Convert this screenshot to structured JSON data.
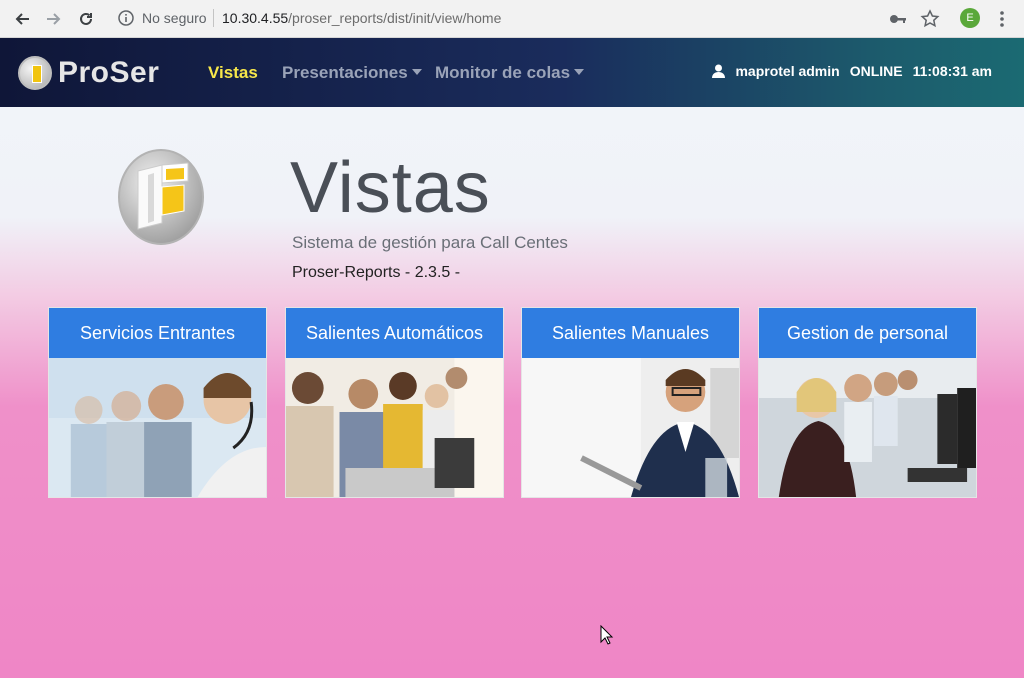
{
  "browser": {
    "security_label": "No seguro",
    "url_host": "10.30.4.55",
    "url_path": "/proser_reports/dist/init/view/home",
    "profile_initial": "E"
  },
  "navbar": {
    "brand": "ProSer",
    "links": [
      {
        "label": "Vistas",
        "active": true
      },
      {
        "label": "Presentaciones",
        "dropdown": true
      },
      {
        "label": "Monitor de colas",
        "dropdown": true
      }
    ],
    "user": "maprotel admin",
    "status": "ONLINE",
    "time": "11:08:31 am"
  },
  "hero": {
    "title": "Vistas",
    "subtitle": "Sistema de gestión para Call Centes",
    "version": "Proser-Reports - 2.3.5 -"
  },
  "cards": [
    {
      "title": "Servicios Entrantes",
      "image": "call-center-agents-headset-photo"
    },
    {
      "title": "Salientes Automáticos",
      "image": "agents-working-computers-photo"
    },
    {
      "title": "Salientes Manuales",
      "image": "agent-with-headset-at-desk-photo"
    },
    {
      "title": "Gestion de personal",
      "image": "agents-row-at-monitors-photo"
    }
  ],
  "colors": {
    "navbar_start": "#0f1638",
    "navbar_end": "#1b6a72",
    "active_link": "#f7e74a",
    "card_header": "#2f7de1",
    "page_bottom": "#ef86c6"
  }
}
